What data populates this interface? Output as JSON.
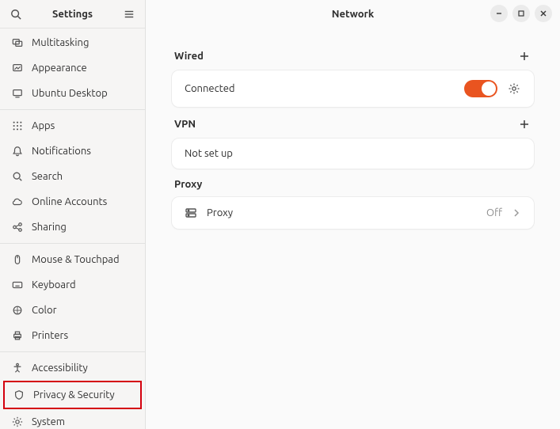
{
  "sidebar": {
    "title": "Settings",
    "items": [
      {
        "label": "Multitasking"
      },
      {
        "label": "Appearance"
      },
      {
        "label": "Ubuntu Desktop"
      }
    ],
    "items2": [
      {
        "label": "Apps"
      },
      {
        "label": "Notifications"
      },
      {
        "label": "Search"
      },
      {
        "label": "Online Accounts"
      },
      {
        "label": "Sharing"
      }
    ],
    "items3": [
      {
        "label": "Mouse & Touchpad"
      },
      {
        "label": "Keyboard"
      },
      {
        "label": "Color"
      },
      {
        "label": "Printers"
      }
    ],
    "items4": [
      {
        "label": "Accessibility"
      },
      {
        "label": "Privacy & Security"
      },
      {
        "label": "System"
      }
    ]
  },
  "main": {
    "title": "Network",
    "wired": {
      "heading": "Wired",
      "status": "Connected"
    },
    "vpn": {
      "heading": "VPN",
      "status": "Not set up"
    },
    "proxy": {
      "heading": "Proxy",
      "row_label": "Proxy",
      "value": "Off"
    }
  }
}
